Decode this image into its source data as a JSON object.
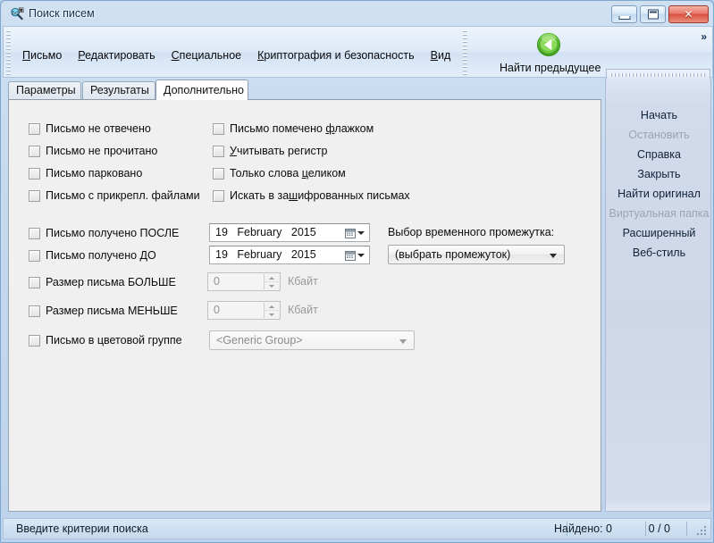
{
  "window": {
    "title": "Поиск писем",
    "icon": "search-mail-icon",
    "controls": {
      "minimize": "minimize-icon",
      "maximize": "maximize-icon",
      "close": "✕"
    }
  },
  "menu": {
    "items": [
      {
        "label": "Письмо",
        "mnemonic": "П"
      },
      {
        "label": "Редактировать",
        "mnemonic": "Р"
      },
      {
        "label": "Специальное",
        "mnemonic": "С"
      },
      {
        "label": "Криптография и безопасность",
        "mnemonic": "К"
      },
      {
        "label": "Вид",
        "mnemonic": "В"
      }
    ],
    "gear_icon": "gear-icon"
  },
  "toolbar": {
    "find_previous": {
      "label": "Найти предыдущее",
      "icon": "back-arrow-icon",
      "icon_color": "#4caf2a"
    },
    "overflow": "»"
  },
  "tabs": [
    {
      "label": "Параметры",
      "active": false
    },
    {
      "label": "Результаты",
      "active": false
    },
    {
      "label": "Дополнительно",
      "active": true
    }
  ],
  "advanced": {
    "checkboxes_left": [
      {
        "label": "Письмо не отвечено",
        "checked": false
      },
      {
        "label": "Письмо не прочитано",
        "checked": false
      },
      {
        "label": "Письмо парковано",
        "checked": false
      },
      {
        "label": "Письмо с прикрепл. файлами",
        "checked": false
      }
    ],
    "checkboxes_right": [
      {
        "pre": "Письмо помечено ",
        "mn": "ф",
        "post": "лажком",
        "checked": false
      },
      {
        "pre": "",
        "mn": "У",
        "post": "читывать регистр",
        "checked": false
      },
      {
        "pre": "Только слова ",
        "mn": "ц",
        "post": "еликом",
        "checked": false
      },
      {
        "pre": "Искать в за",
        "mn": "ш",
        "post": "ифрованных письмах",
        "checked": false
      }
    ],
    "date_after": {
      "label": "Письмо получено ПОСЛЕ",
      "checked": false,
      "day": "19",
      "month": "February",
      "year": "2015",
      "icon": "calendar-icon"
    },
    "date_before": {
      "label": "Письмо получено ДО",
      "checked": false,
      "day": "19",
      "month": "February",
      "year": "2015",
      "icon": "calendar-icon"
    },
    "timespan": {
      "label": "Выбор временного промежутка:",
      "value": "(выбрать промежуток)"
    },
    "size_greater": {
      "label": "Размер письма БОЛЬШЕ",
      "checked": false,
      "value": "0",
      "unit": "Кбайт"
    },
    "size_less": {
      "label": "Размер письма МЕНЬШЕ",
      "checked": false,
      "value": "0",
      "unit": "Кбайт"
    },
    "color_group": {
      "label": "Письмо в цветовой группе",
      "checked": false,
      "value": "<Generic Group>"
    }
  },
  "sidebar": {
    "items": [
      {
        "label": "Начать",
        "disabled": false
      },
      {
        "label": "Остановить",
        "disabled": true
      },
      {
        "label": "Справка",
        "disabled": false
      },
      {
        "label": "Закрыть",
        "disabled": false
      },
      {
        "label": "Найти оригинал",
        "disabled": false
      },
      {
        "label": "Виртуальная папка",
        "disabled": true
      },
      {
        "label": "Расширенный",
        "disabled": false
      },
      {
        "label": "Веб-стиль",
        "disabled": false
      }
    ]
  },
  "statusbar": {
    "message": "Введите критерии поиска",
    "found": "Найдено: 0",
    "position": "0 / 0"
  }
}
